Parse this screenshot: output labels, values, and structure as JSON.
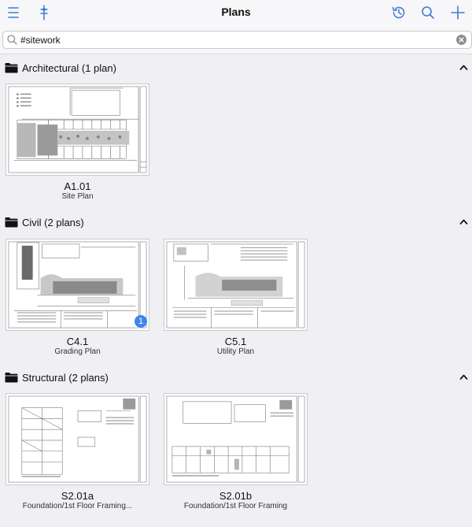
{
  "header": {
    "title": "Plans",
    "menu_icon": "menu-icon",
    "layers_icon": "layers-icon",
    "history_icon": "history-icon",
    "search_icon": "search-icon",
    "add_icon": "plus-icon",
    "accent_color": "#3e7ad6"
  },
  "search": {
    "value": "#sitework",
    "placeholder": ""
  },
  "sections": [
    {
      "title": "Architectural (1 plan)",
      "plans": [
        {
          "code": "A1.01",
          "name": "Site Plan"
        }
      ]
    },
    {
      "title": "Civil (2 plans)",
      "plans": [
        {
          "code": "C4.1",
          "name": "Grading Plan",
          "badge": "1"
        },
        {
          "code": "C5.1",
          "name": "Utility Plan"
        }
      ]
    },
    {
      "title": "Structural (2 plans)",
      "plans": [
        {
          "code": "S2.01a",
          "name": "Foundation/1st Floor Framing..."
        },
        {
          "code": "S2.01b",
          "name": "Foundation/1st Floor Framing"
        }
      ]
    }
  ],
  "colors": {
    "badge": "#3e84f0",
    "background": "#efeff4"
  }
}
